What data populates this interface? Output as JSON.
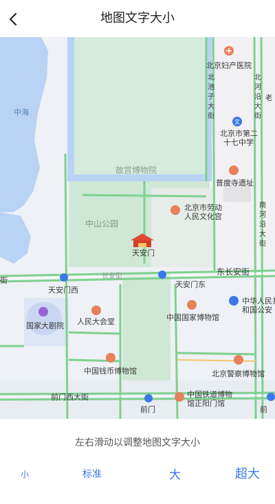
{
  "header": {
    "title": "地图文字大小",
    "back_icon": "chevron-left-icon"
  },
  "map": {
    "labels": {
      "zhonghai": "中海",
      "gugong": "故宫博物院",
      "zhongshan": "中山公园",
      "tiananmen": "天安门",
      "changan_mid": "长安街",
      "changan_left": "街",
      "dong_changan": "东长安街",
      "tam_west": "天安门西",
      "tam_east": "天安门东",
      "grand_theatre": "国家大剧院",
      "great_hall": "人民大会堂",
      "nat_museum": "中国国家博物馆",
      "money_museum": "中国钱币博物馆",
      "qianmen_west": "前门西大街",
      "qianmen": "前门",
      "rail_museum_1": "中国铁道博物",
      "rail_museum_2": "馆正阳门馆",
      "police_museum": "北京警察博物馆",
      "maternity": "北京妇产医院",
      "beichizi_1": "北",
      "beichizi_2": "池",
      "beichizi_3": "子",
      "beichizi_4": "大",
      "beichizi_5": "街",
      "nanheyan_1": "北",
      "nanheyan_2": "河",
      "nanheyan_3": "沿",
      "nanheyan_4": "大",
      "nanheyan_5": "街",
      "school_1": "北京市第二",
      "school_2": "十七中学",
      "pudu": "普度寺遗址",
      "culture_1": "北京市劳动",
      "culture_2": "人民文化宫",
      "prc_1": "中华人民共",
      "prc_2": "和国公安",
      "nanhe_1": "南",
      "nanhe_2": "河",
      "nanhe_3": "沿",
      "nanhe_4": "大",
      "nanhe_5": "街",
      "qian_right": "前",
      "lao": "老"
    }
  },
  "panel": {
    "hint": "左右滑动以调整地图文字大小",
    "options": [
      "小",
      "标准",
      "大",
      "超大"
    ]
  },
  "colors": {
    "accent": "#3b78e7",
    "water": "#b8d3f3",
    "park": "#cfe8d6",
    "road": "#7fd08f",
    "poi": "#e8805b"
  }
}
